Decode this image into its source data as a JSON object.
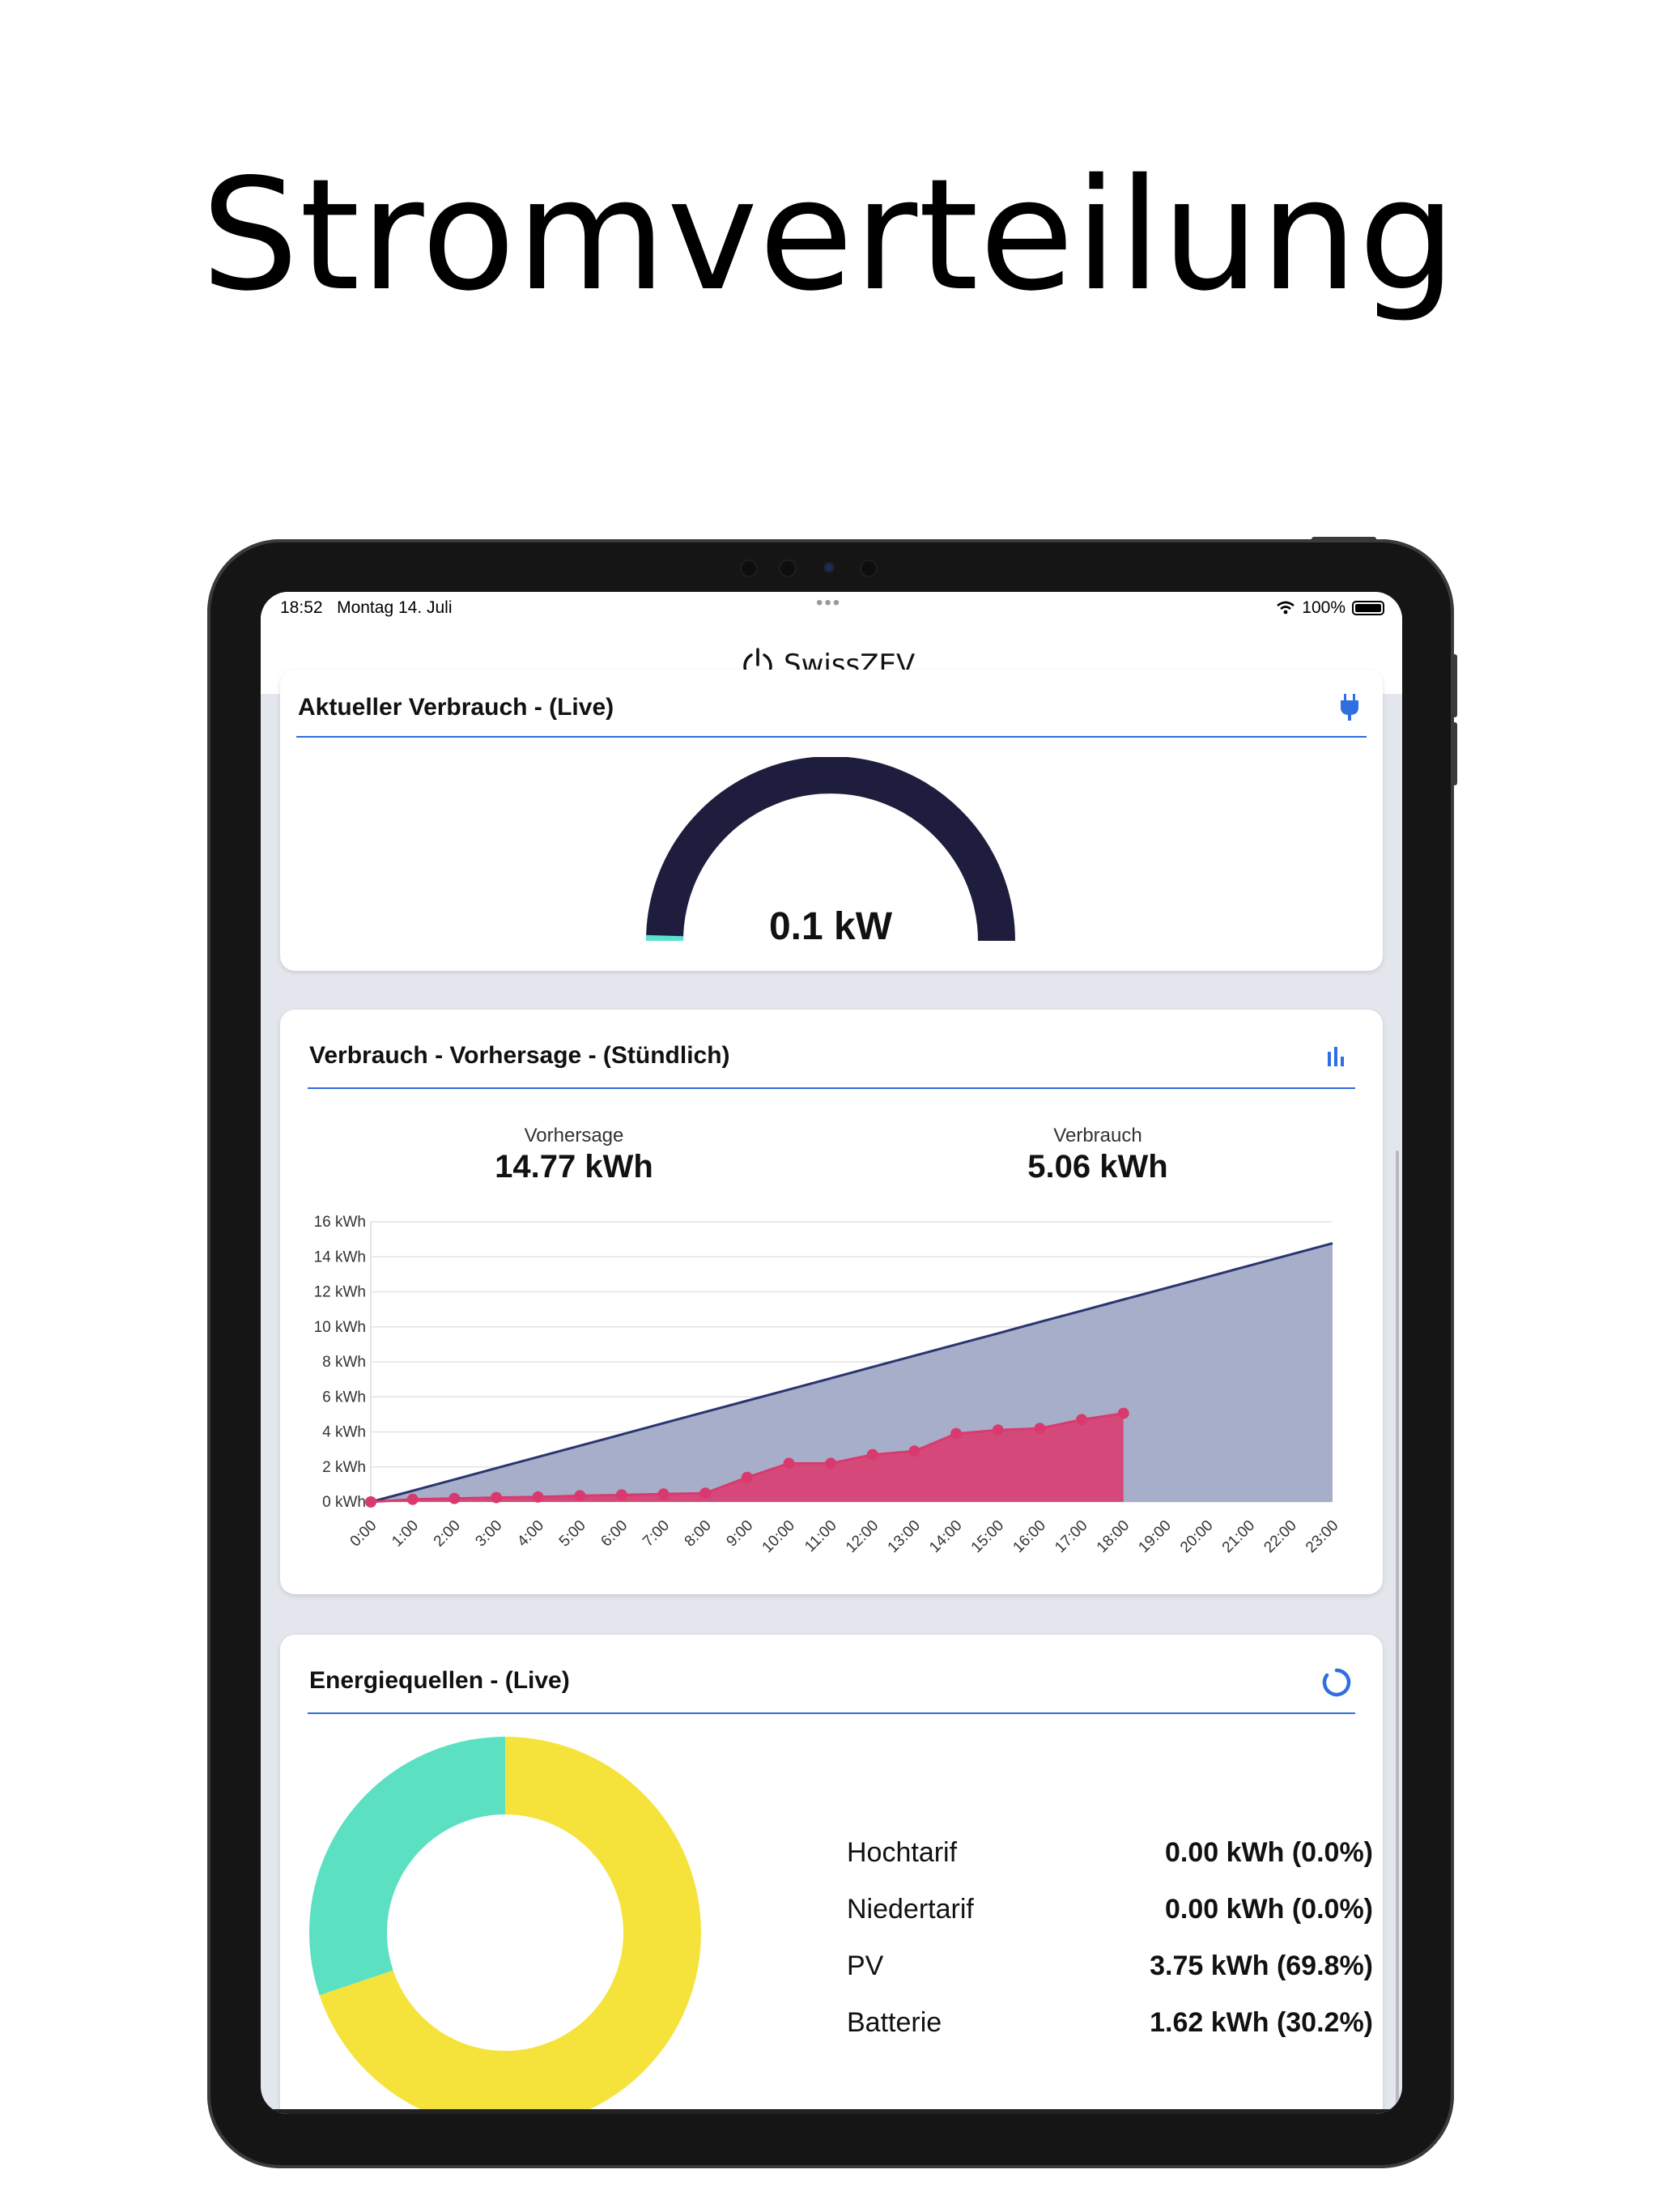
{
  "headline": "Stromverteilung",
  "statusbar": {
    "time": "18:52",
    "date": "Montag 14. Juli",
    "battery": "100%"
  },
  "app": {
    "title": "SwissZEV",
    "logo_icon": "power-icon"
  },
  "live_card": {
    "title": "Aktueller Verbrauch - (Live)",
    "icon": "plug-icon",
    "gauge_value": "0.1 kW",
    "gauge_fraction": 0.01,
    "colors": {
      "track": "#1f1d3d",
      "fill": "#5ce0d0"
    }
  },
  "forecast_card": {
    "title": "Verbrauch - Vorhersage - (Stündlich)",
    "icon": "bar-chart-icon",
    "forecast_label": "Vorhersage",
    "forecast_value": "14.77 kWh",
    "usage_label": "Verbrauch",
    "usage_value": "5.06 kWh"
  },
  "sources_card": {
    "title": "Energiequellen - (Live)",
    "icon": "refresh-icon",
    "items": [
      {
        "label": "Hochtarif",
        "value": "0.00 kWh (0.0%)"
      },
      {
        "label": "Niedertarif",
        "value": "0.00 kWh (0.0%)"
      },
      {
        "label": "PV",
        "value": "3.75 kWh (69.8%)"
      },
      {
        "label": "Batterie",
        "value": "1.62 kWh (30.2%)"
      }
    ],
    "donut": [
      {
        "label": "PV",
        "percent": 69.8,
        "color": "#f5e33c"
      },
      {
        "label": "Batterie",
        "percent": 30.2,
        "color": "#5ce0c2"
      }
    ]
  },
  "chart_data": {
    "type": "area",
    "x": [
      "0:00",
      "1:00",
      "2:00",
      "3:00",
      "4:00",
      "5:00",
      "6:00",
      "7:00",
      "8:00",
      "9:00",
      "10:00",
      "11:00",
      "12:00",
      "13:00",
      "14:00",
      "15:00",
      "16:00",
      "17:00",
      "18:00",
      "19:00",
      "20:00",
      "21:00",
      "22:00",
      "23:00"
    ],
    "y_ticks": [
      "0 kWh",
      "2 kWh",
      "4 kWh",
      "6 kWh",
      "8 kWh",
      "10 kWh",
      "12 kWh",
      "14 kWh",
      "16 kWh"
    ],
    "ylim": [
      0,
      16
    ],
    "grid": true,
    "series": [
      {
        "key": "forecast",
        "values": [
          0,
          0.64,
          1.28,
          1.93,
          2.57,
          3.21,
          3.85,
          4.5,
          5.14,
          5.78,
          6.42,
          7.06,
          7.71,
          8.35,
          8.99,
          9.63,
          10.28,
          10.92,
          11.56,
          12.2,
          12.84,
          13.49,
          14.13,
          14.77
        ],
        "color": "#2a3570",
        "fill": "#a7aec9"
      },
      {
        "key": "usage",
        "values": [
          0,
          0.15,
          0.2,
          0.25,
          0.28,
          0.35,
          0.4,
          0.45,
          0.5,
          1.4,
          2.2,
          2.2,
          2.7,
          2.9,
          3.9,
          4.1,
          4.2,
          4.7,
          5.06
        ],
        "color": "#d93a6e",
        "fill": "#d5497a"
      }
    ]
  }
}
